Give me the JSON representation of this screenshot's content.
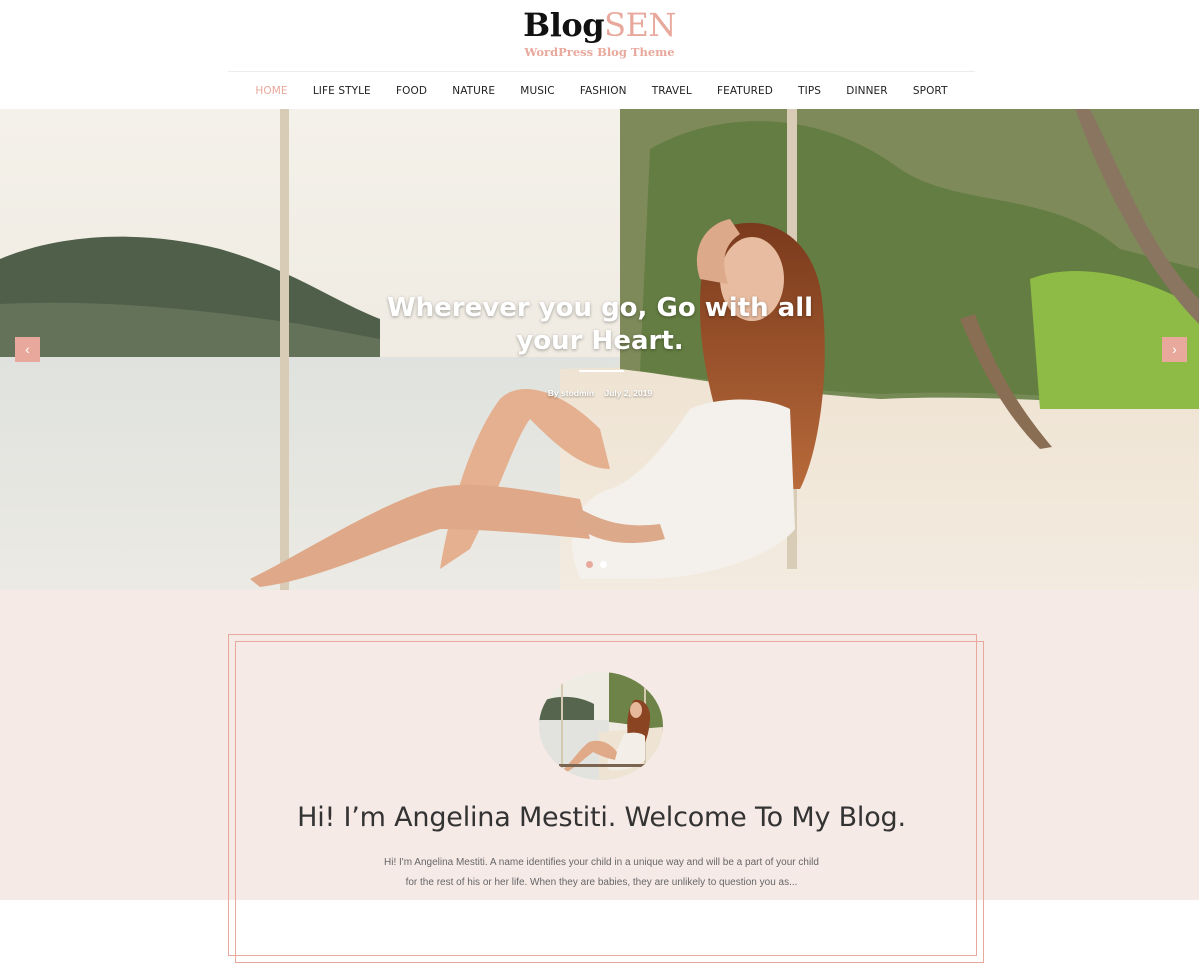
{
  "header": {
    "logo_part1": "Blog",
    "logo_part2": "SEN",
    "tagline": "WordPress Blog Theme"
  },
  "nav": {
    "items": [
      "HOME",
      "LIFE STYLE",
      "FOOD",
      "NATURE",
      "MUSIC",
      "FASHION",
      "TRAVEL",
      "FEATURED",
      "TIPS",
      "DINNER",
      "SPORT"
    ],
    "active_index": 0
  },
  "hero": {
    "title": "Wherever you go, Go with all your Heart.",
    "author": "By stodmin",
    "date": "July 2, 2019",
    "prev_icon": "chevron-left-icon",
    "next_icon": "chevron-right-icon",
    "prev_glyph": "‹",
    "next_glyph": "›",
    "slides_count": 2,
    "active_slide": 0
  },
  "about": {
    "heading": "Hi! I’m Angelina Mestiti. Welcome To My Blog.",
    "text_line1": "Hi! I'm Angelina Mestiti. A name identifies your child in a unique way and will be a part of your child",
    "text_line2": "for the rest of his or her life. When they are babies, they are unlikely to question you as..."
  },
  "colors": {
    "accent": "#e8a99c",
    "about_bg": "#f6eae7",
    "text_dark": "#333333"
  }
}
